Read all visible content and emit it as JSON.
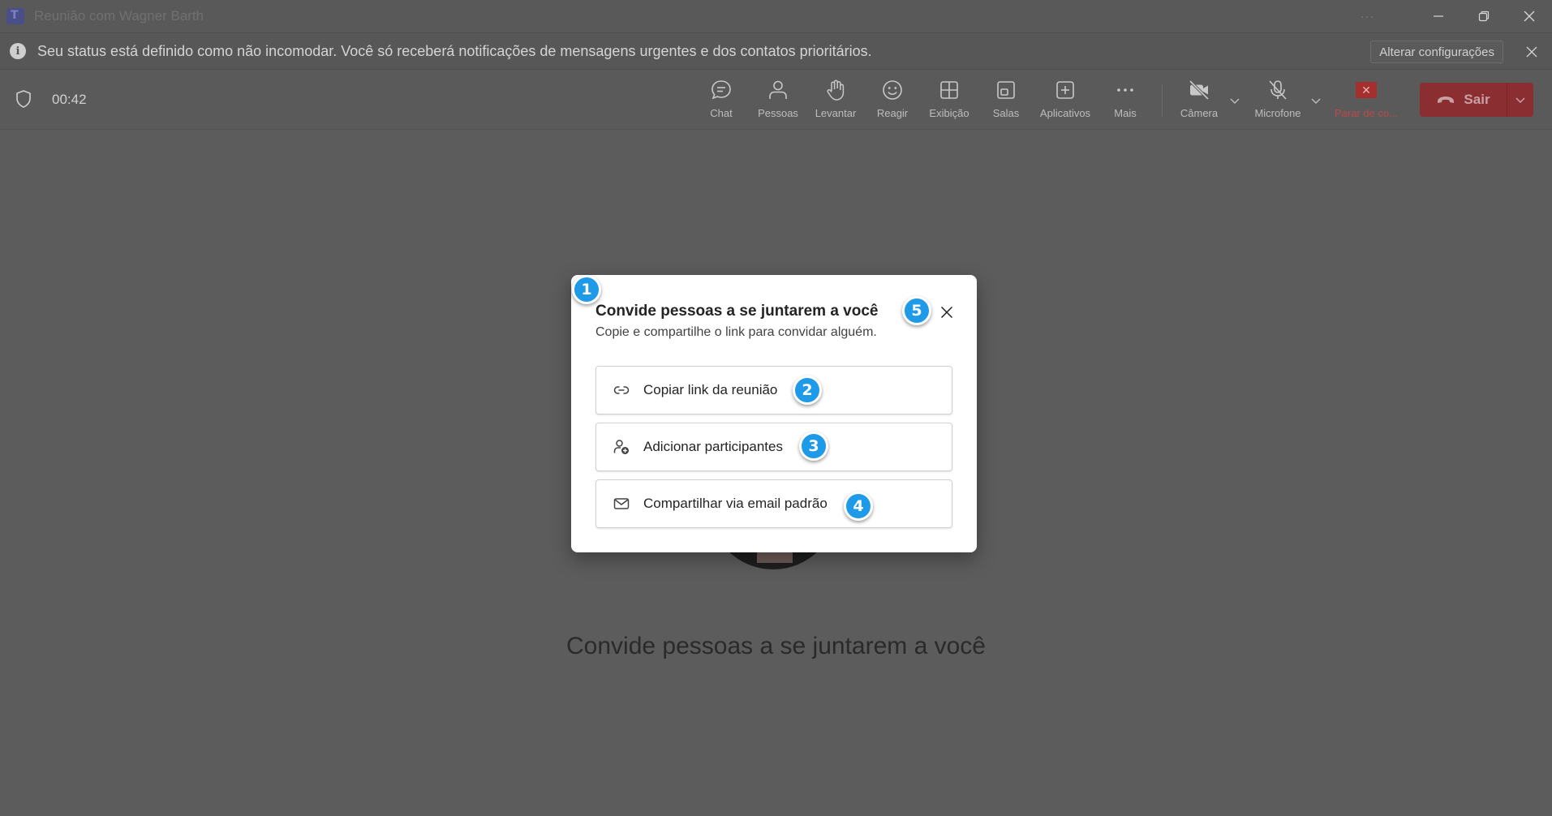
{
  "window": {
    "title": "Reunião com Wagner Barth",
    "more": "···"
  },
  "notification": {
    "text": "Seu status está definido como não incomodar. Você só receberá notificações de mensagens urgentes e dos contatos prioritários.",
    "action_label": "Alterar configurações"
  },
  "toolbar": {
    "timer": "00:42",
    "buttons": [
      {
        "label": "Chat",
        "icon": "chat-icon"
      },
      {
        "label": "Pessoas",
        "icon": "people-icon"
      },
      {
        "label": "Levantar",
        "icon": "raise-hand-icon"
      },
      {
        "label": "Reagir",
        "icon": "react-icon"
      },
      {
        "label": "Exibição",
        "icon": "view-icon"
      },
      {
        "label": "Salas",
        "icon": "rooms-icon"
      },
      {
        "label": "Aplicativos",
        "icon": "apps-icon"
      },
      {
        "label": "Mais",
        "icon": "more-icon"
      },
      {
        "label": "Câmera",
        "icon": "camera-off-icon"
      },
      {
        "label": "Microfone",
        "icon": "mic-off-icon"
      },
      {
        "label": "Parar de co...",
        "icon": "stop-share-icon"
      }
    ],
    "leave_label": "Sair"
  },
  "stage": {
    "title": "Convide pessoas a se juntarem a você"
  },
  "dialog": {
    "title": "Convide pessoas a se juntarem a você",
    "subtitle": "Copie e compartilhe o link para convidar alguém.",
    "options": [
      {
        "label": "Copiar link da reunião",
        "icon": "link-icon"
      },
      {
        "label": "Adicionar participantes",
        "icon": "add-person-icon"
      },
      {
        "label": "Compartilhar via email padrão",
        "icon": "mail-icon"
      }
    ]
  },
  "badges": [
    "1",
    "2",
    "3",
    "4",
    "5"
  ],
  "colors": {
    "badge": "#1e9ae8",
    "leave": "#8a2e32",
    "overlay": "#5c5c5c"
  }
}
